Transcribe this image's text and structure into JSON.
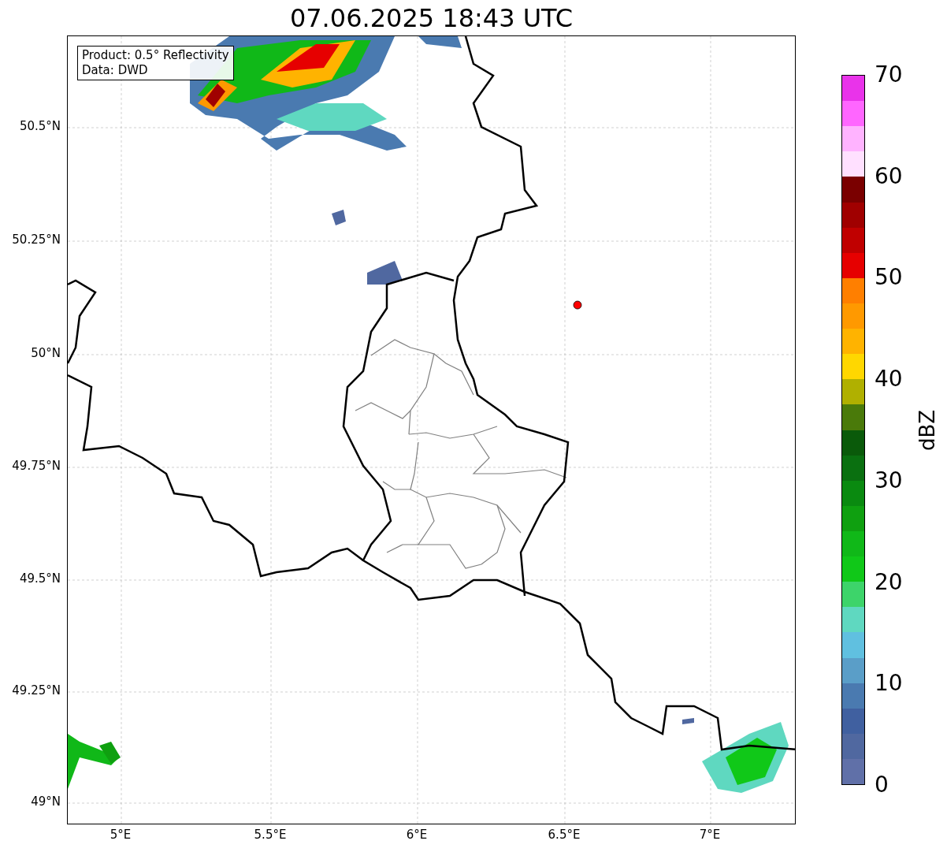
{
  "title": "07.06.2025 18:43 UTC",
  "info_box": [
    "Product: 0.5° Reflectivity",
    "Data: DWD"
  ],
  "lat_labels": [
    "50.5°N",
    "50.25°N",
    "50°N",
    "49.75°N",
    "49.5°N",
    "49.25°N",
    "49°N"
  ],
  "lon_labels": [
    "5°E",
    "5.5°E",
    "6°E",
    "6.5°E",
    "7°E"
  ],
  "colorbar": {
    "label": "dBZ",
    "ticks": [
      "70",
      "60",
      "50",
      "40",
      "30",
      "20",
      "10",
      "0"
    ],
    "segments": [
      {
        "color": "#e933ea"
      },
      {
        "color": "#ff66ff"
      },
      {
        "color": "#ffb3ff"
      },
      {
        "color": "#ffe0ff"
      },
      {
        "color": "#7a0000"
      },
      {
        "color": "#a00000"
      },
      {
        "color": "#c00000"
      },
      {
        "color": "#e60000"
      },
      {
        "color": "#ff7f00"
      },
      {
        "color": "#ff9900"
      },
      {
        "color": "#ffb300"
      },
      {
        "color": "#ffd700"
      },
      {
        "color": "#b0b000"
      },
      {
        "color": "#4a7a0a"
      },
      {
        "color": "#0a5a0a"
      },
      {
        "color": "#0a7010"
      },
      {
        "color": "#0a8a10"
      },
      {
        "color": "#0fa010"
      },
      {
        "color": "#10b818"
      },
      {
        "color": "#10c818"
      },
      {
        "color": "#3dd46a"
      },
      {
        "color": "#5fd8c0"
      },
      {
        "color": "#60c0e0"
      },
      {
        "color": "#5a9ec8"
      },
      {
        "color": "#4a7ab0"
      },
      {
        "color": "#4060a0"
      },
      {
        "color": "#5068a0"
      },
      {
        "color": "#6070a8"
      }
    ]
  }
}
